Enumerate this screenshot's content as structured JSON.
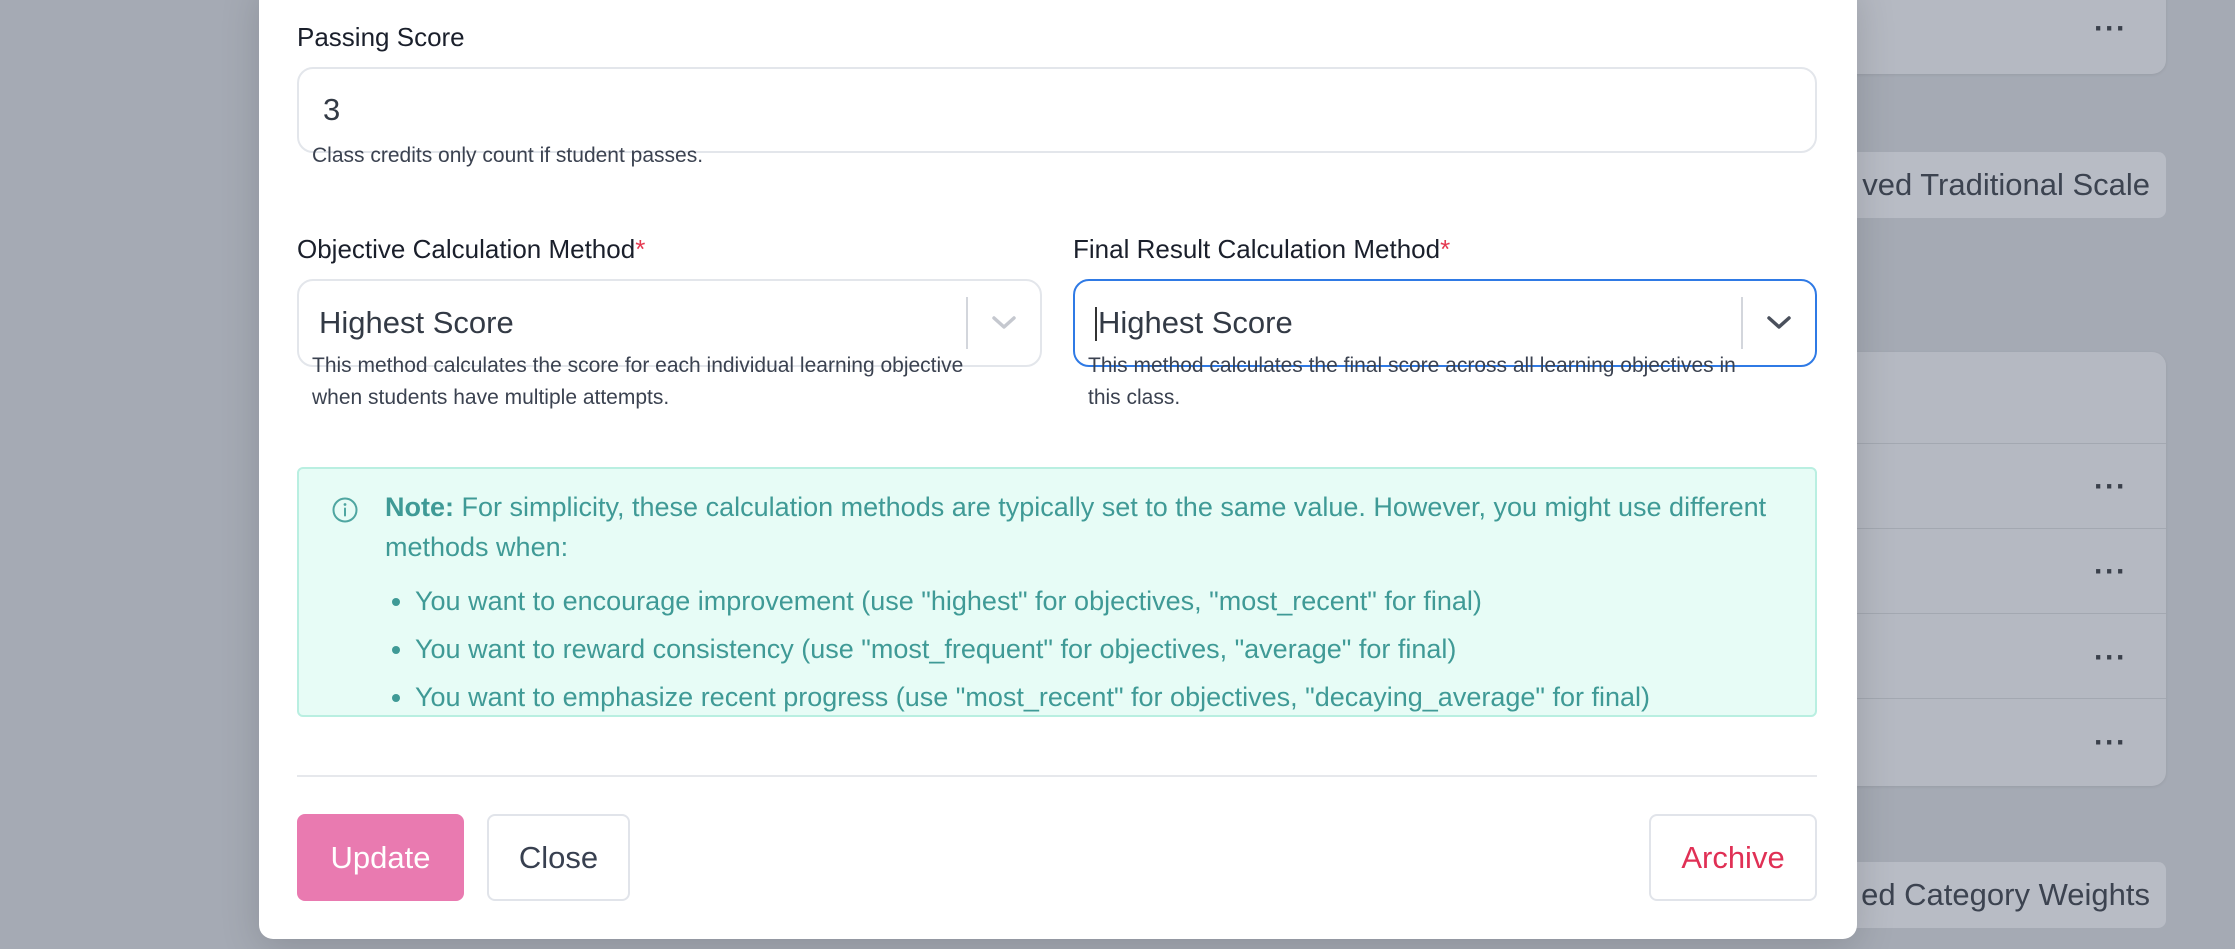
{
  "background": {
    "pills": [
      "ved Traditional Scale",
      "ed Category Weights"
    ],
    "menu_glyph": "···"
  },
  "modal": {
    "passing_score": {
      "label": "Passing Score",
      "value": "3",
      "help": "Class credits only count if student passes."
    },
    "objective_method": {
      "label": "Objective Calculation Method",
      "required_mark": "*",
      "value": "Highest Score",
      "help_line1": "This method calculates the score for each individual learning objective",
      "help_line2": "when students have multiple attempts."
    },
    "final_method": {
      "label": "Final Result Calculation Method",
      "required_mark": "*",
      "value": "Highest Score",
      "help_line1": "This method calculates the final score across all learning objectives in",
      "help_line2": "this class."
    },
    "note": {
      "title": "Note:",
      "body": "For simplicity, these calculation methods are typically set to the same value. However, you might use different methods when:",
      "bullets": [
        "You want to encourage improvement (use \"highest\" for objectives, \"most_recent\" for final)",
        "You want to reward consistency (use \"most_frequent\" for objectives, \"average\" for final)",
        "You want to emphasize recent progress (use \"most_recent\" for objectives, \"decaying_average\" for final)"
      ]
    },
    "buttons": {
      "update": "Update",
      "close": "Close",
      "archive": "Archive"
    }
  },
  "colors": {
    "primary": "#e97ab0",
    "danger": "#e03055",
    "focus": "#2f7ae5",
    "note_bg": "#e7fcf6",
    "note_text": "#3f9a96"
  }
}
